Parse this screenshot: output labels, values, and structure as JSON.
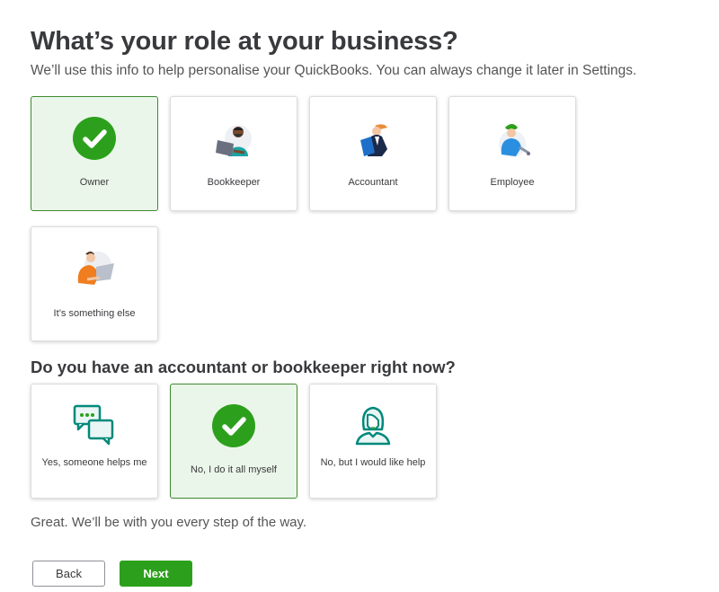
{
  "page": {
    "title": "What’s your role at your business?",
    "subtitle": "We’ll use this info to help personalise your QuickBooks. You can always change it later in Settings."
  },
  "role": {
    "options": [
      {
        "label": "Owner",
        "icon": "check-icon",
        "selected": true
      },
      {
        "label": "Bookkeeper",
        "icon": "bookkeeper-illustration",
        "selected": false
      },
      {
        "label": "Accountant",
        "icon": "accountant-illustration",
        "selected": false
      },
      {
        "label": "Employee",
        "icon": "employee-illustration",
        "selected": false
      },
      {
        "label": "It’s something else",
        "icon": "something-else-illustration",
        "selected": false
      }
    ]
  },
  "accountant_question": {
    "heading": "Do you have an accountant or bookkeeper right now?",
    "options": [
      {
        "label": "Yes, someone helps me",
        "icon": "chat-bubbles-icon",
        "selected": false
      },
      {
        "label": "No, I do it all myself",
        "icon": "check-icon",
        "selected": true
      },
      {
        "label": "No, but I would like help",
        "icon": "person-outline-icon",
        "selected": false
      }
    ]
  },
  "feedback": "Great. We’ll be with you every step of the way.",
  "buttons": {
    "back": "Back",
    "next": "Next"
  },
  "colors": {
    "accent": "#2ca01c",
    "selected_bg": "#ebf6ea",
    "selected_border": "#3c8a2e",
    "icon_teal": "#00897b"
  }
}
